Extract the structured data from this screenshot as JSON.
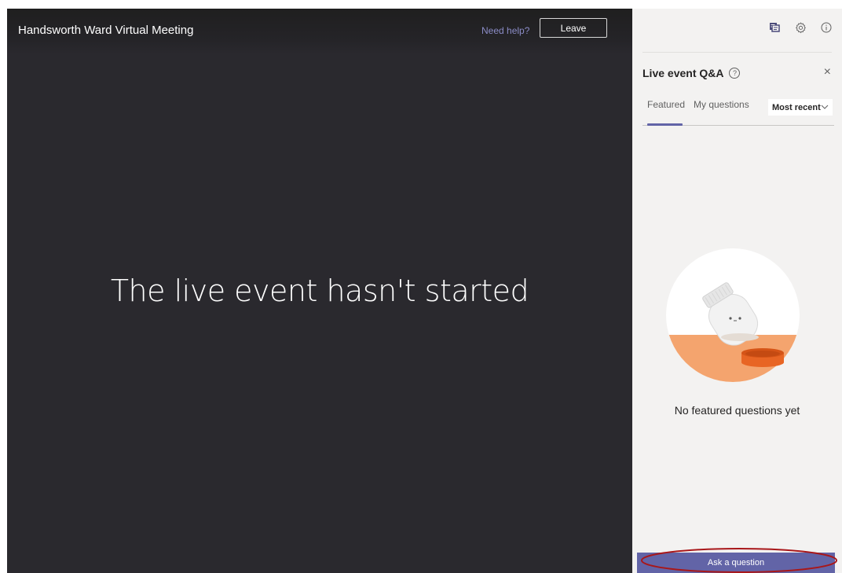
{
  "stage": {
    "meeting_title": "Handsworth Ward Virtual Meeting",
    "help_link": "Need help?",
    "leave_label": "Leave",
    "message": "The live event hasn't started"
  },
  "panel": {
    "top_icons": [
      "qa-icon",
      "gear-icon",
      "info-icon"
    ],
    "title": "Live event Q&A",
    "help_glyph": "?",
    "close_glyph": "×",
    "tabs": [
      {
        "label": "Featured",
        "selected": true
      },
      {
        "label": "My questions",
        "selected": false
      }
    ],
    "sort_value": "Most recent",
    "empty_message": "No featured questions yet",
    "ask_label": "Ask a question"
  },
  "colors": {
    "stage_bg": "#2a292e",
    "panel_bg": "#f3f2f1",
    "accent": "#6264a7",
    "link": "#8b8cc7",
    "highlight_ring": "#a8171a",
    "illustration_orange": "#f4a46e"
  }
}
